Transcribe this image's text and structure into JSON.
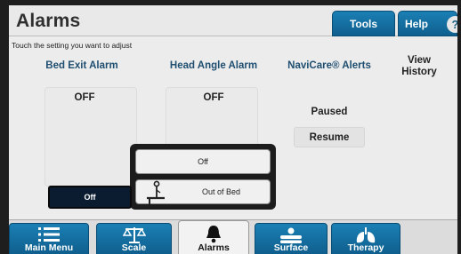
{
  "header": {
    "title": "Alarms",
    "tools_label": "Tools",
    "help_label": "Help",
    "help_badge": "?"
  },
  "instruction": "Touch the setting you want to adjust",
  "columns": {
    "bed_exit": {
      "label": "Bed Exit Alarm",
      "value": "OFF"
    },
    "head_angle": {
      "label": "Head Angle Alarm",
      "value": "OFF"
    },
    "navicare": {
      "label": "NaviCare® Alerts",
      "status": "Paused",
      "action": "Resume"
    },
    "history": {
      "label_line1": "View",
      "label_line2": "History"
    }
  },
  "dropdown": {
    "selected": "Off",
    "options": [
      "Off",
      "Out of Bed"
    ]
  },
  "bottom_nav": {
    "items": [
      {
        "label": "Main Menu",
        "icon": "list-icon",
        "active": false
      },
      {
        "label": "Scale",
        "icon": "scale-icon",
        "active": false
      },
      {
        "label": "Alarms",
        "icon": "bell-icon",
        "active": true
      },
      {
        "label": "Surface",
        "icon": "surface-icon",
        "active": false
      },
      {
        "label": "Therapy",
        "icon": "lungs-icon",
        "active": false
      }
    ]
  },
  "colors": {
    "tab_blue": "#1b7fb4",
    "heading_blue": "#1f4e70",
    "selected_dark": "#0c1c30"
  }
}
